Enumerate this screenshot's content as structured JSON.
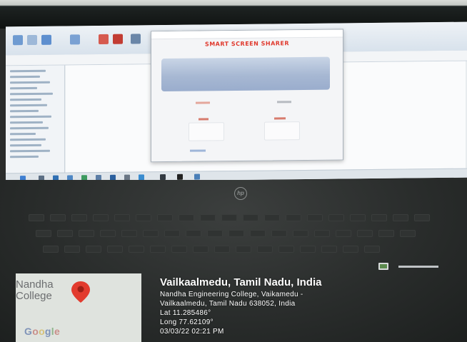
{
  "app": {
    "title": "SMART SCREEN SHARER"
  },
  "map": {
    "place_line1": "Nandha",
    "place_line2": "College",
    "pin_icon": "map-pin-icon",
    "pin_color": "#e23b2e",
    "brand_logo": "Google"
  },
  "gps_card": {
    "badge_icon": "camera-icon",
    "title": "Vailkaalmedu, Tamil Nadu, India",
    "address_line1": "Nandha Engineering College, Vaikamedu -",
    "address_line2": "Vailkaalmedu, Tamil Nadu 638052, India",
    "lat": "Lat 11.285486°",
    "long": "Long 77.62109°",
    "datetime": "03/03/22 02:21 PM"
  },
  "colors": {
    "app_title": "#e0382c",
    "status_panel": "#a7b8d3",
    "laptop_body": "#2a2d2c"
  }
}
